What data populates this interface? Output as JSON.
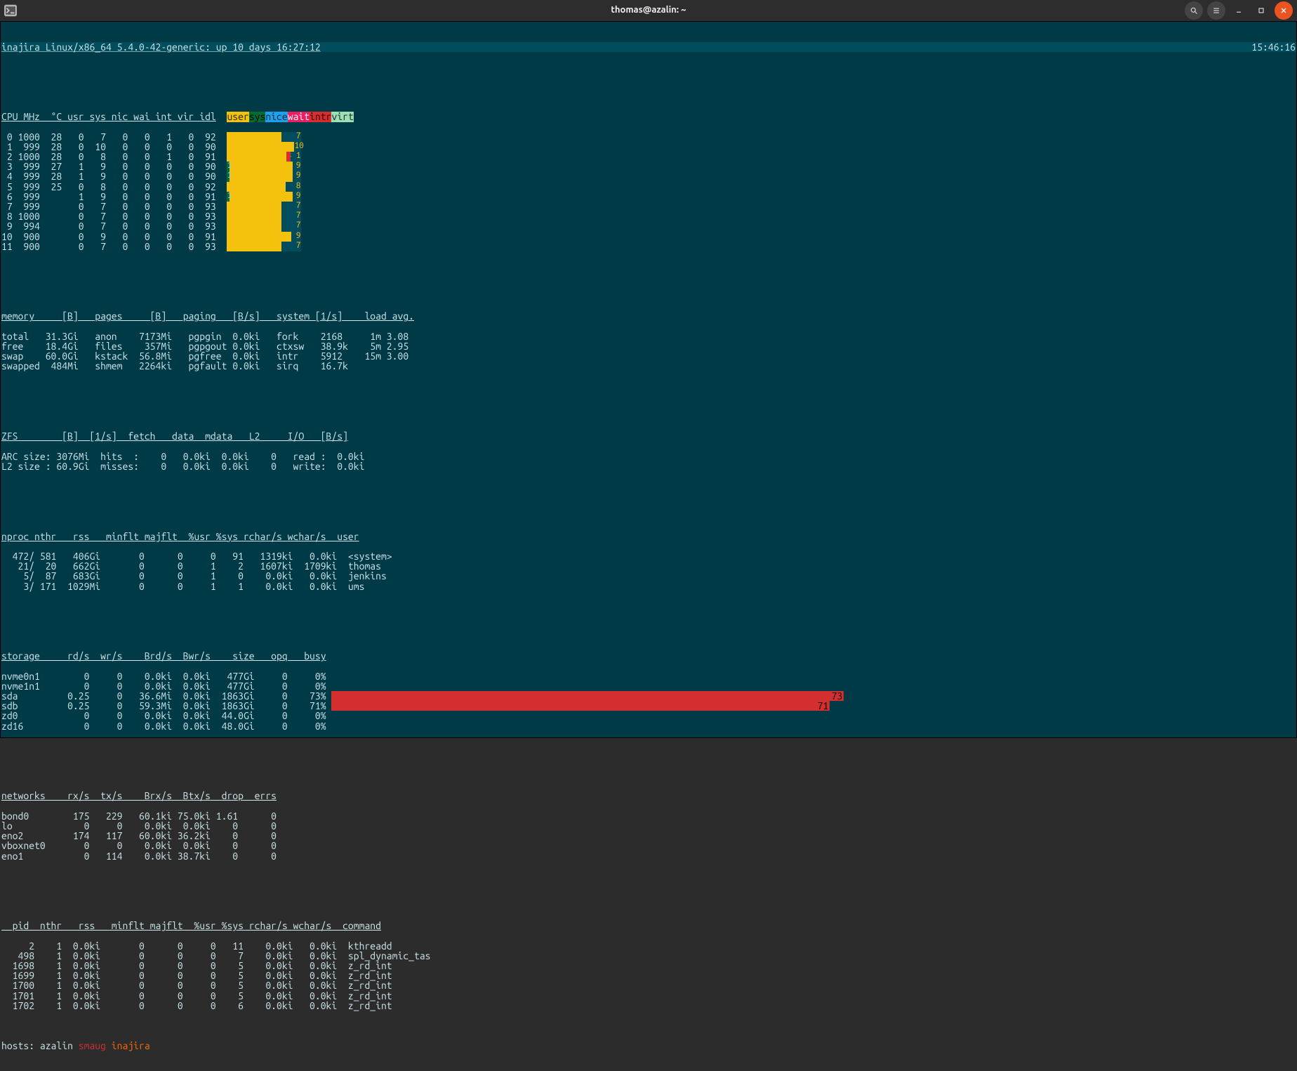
{
  "window": {
    "title": "thomas@azalin: ~",
    "app_icon": "terminal-icon"
  },
  "header": {
    "hostinfo": "inajira Linux/x86_64 5.4.0-42-generic: up 10 days 16:27:12",
    "clock": "15:46:16"
  },
  "cpu": {
    "columns": "CPU MHz  °C usr sys nic wai int vir idl",
    "legend": [
      "user",
      "sys",
      "nice",
      "wait",
      "intr",
      "virt"
    ],
    "rows": [
      {
        "n": 0,
        "mhz": 1000,
        "c": 28,
        "usr": 0,
        "sys": 7,
        "nic": 0,
        "wai": 0,
        "int": 1,
        "vir": 0,
        "idl": 92,
        "bar_sys": 78,
        "bar_wait": 0,
        "label": "7"
      },
      {
        "n": 1,
        "mhz": 999,
        "c": 28,
        "usr": 0,
        "sys": 10,
        "nic": 0,
        "wai": 0,
        "int": 0,
        "vir": 0,
        "idl": 90,
        "bar_sys": 96,
        "bar_wait": 0,
        "label": "10",
        "tail": ""
      },
      {
        "n": 2,
        "mhz": 1000,
        "c": 28,
        "usr": 0,
        "sys": 8,
        "nic": 0,
        "wai": 0,
        "int": 1,
        "vir": 0,
        "idl": 91,
        "bar_sys": 85,
        "bar_wait": 6,
        "label": "8 1"
      },
      {
        "n": 3,
        "mhz": 999,
        "c": 27,
        "usr": 1,
        "sys": 9,
        "nic": 0,
        "wai": 0,
        "int": 0,
        "vir": 0,
        "idl": 90,
        "bar_sys": 94,
        "bar_wait": 0,
        "label": "9",
        "user": "1"
      },
      {
        "n": 4,
        "mhz": 999,
        "c": 28,
        "usr": 1,
        "sys": 9,
        "nic": 0,
        "wai": 0,
        "int": 0,
        "vir": 0,
        "idl": 90,
        "bar_sys": 94,
        "bar_wait": 0,
        "label": "9",
        "user": "1"
      },
      {
        "n": 5,
        "mhz": 999,
        "c": 25,
        "usr": 0,
        "sys": 8,
        "nic": 0,
        "wai": 0,
        "int": 0,
        "vir": 0,
        "idl": 92,
        "bar_sys": 84,
        "bar_wait": 0,
        "label": "8"
      },
      {
        "n": 6,
        "mhz": 999,
        "c": " ",
        "usr": 1,
        "sys": 9,
        "nic": 0,
        "wai": 0,
        "int": 0,
        "vir": 0,
        "idl": 91,
        "bar_sys": 94,
        "bar_wait": 0,
        "label": "9",
        "user": "1"
      },
      {
        "n": 7,
        "mhz": 999,
        "c": " ",
        "usr": 0,
        "sys": 7,
        "nic": 0,
        "wai": 0,
        "int": 0,
        "vir": 0,
        "idl": 93,
        "bar_sys": 78,
        "bar_wait": 0,
        "label": "7"
      },
      {
        "n": 8,
        "mhz": 1000,
        "c": " ",
        "usr": 0,
        "sys": 7,
        "nic": 0,
        "wai": 0,
        "int": 0,
        "vir": 0,
        "idl": 93,
        "bar_sys": 78,
        "bar_wait": 0,
        "label": "7"
      },
      {
        "n": 9,
        "mhz": 994,
        "c": " ",
        "usr": 0,
        "sys": 7,
        "nic": 0,
        "wai": 0,
        "int": 0,
        "vir": 0,
        "idl": 93,
        "bar_sys": 78,
        "bar_wait": 0,
        "label": "7"
      },
      {
        "n": 10,
        "mhz": 900,
        "c": " ",
        "usr": 0,
        "sys": 9,
        "nic": 0,
        "wai": 0,
        "int": 0,
        "vir": 0,
        "idl": 91,
        "bar_sys": 92,
        "bar_wait": 0,
        "label": "9"
      },
      {
        "n": 11,
        "mhz": 900,
        "c": " ",
        "usr": 0,
        "sys": 7,
        "nic": 0,
        "wai": 0,
        "int": 0,
        "vir": 0,
        "idl": 93,
        "bar_sys": 78,
        "bar_wait": 0,
        "label": "7"
      }
    ]
  },
  "memory": {
    "header": "memory     [B]   pages     [B]   paging   [B/s]   system [1/s]    load avg.",
    "rows": [
      "total   31.3Gi   anon    7173Mi   pgpgin  0.0ki   fork    2168     1m 3.08",
      "free    18.4Gi   files    357Mi   pgpgout 0.0ki   ctxsw   38.9k    5m 2.95",
      "swap    60.0Gi   kstack  56.8Mi   pgfree  0.0ki   intr    5912    15m 3.00",
      "swapped  484Mi   shmem   2264ki   pgfault 0.0ki   sirq    16.7k"
    ]
  },
  "zfs": {
    "header": "ZFS        [B]  [1/s]  fetch   data  mdata   L2     I/O   [B/s]",
    "rows": [
      "ARC size: 3076Mi  hits  :    0   0.0ki  0.0ki    0   read :  0.0ki",
      "L2 size : 60.9Gi  misses:    0   0.0ki  0.0ki    0   write:  0.0ki"
    ]
  },
  "nproc": {
    "header": "nproc nthr   rss   minflt majflt  %usr %sys rchar/s wchar/s  user",
    "rows": [
      "  472/ 581   406Gi       0      0     0   91   1319ki   0.0ki  <system>",
      "   21/  20   662Gi       0      0     1    2   1607ki  1709ki  thomas",
      "    5/  87   683Gi       0      0     1    0    0.0ki   0.0ki  jenkins",
      "    3/ 171  1029Mi       0      0     1    1    0.0ki   0.0ki  ums"
    ]
  },
  "storage": {
    "header": "storage     rd/s  wr/s    Brd/s  Bwr/s    size   opq   busy",
    "rows": [
      {
        "txt": "nvme0n1        0     0    0.0ki  0.0ki   477Gi     0     0%",
        "busy": 0
      },
      {
        "txt": "nvme1n1        0     0    0.0ki  0.0ki   477Gi     0     0%",
        "busy": 0
      },
      {
        "txt": "sda         0.25     0   36.6Mi  0.0ki  1863Gi     0    73%",
        "busy": 73,
        "barlabel": "73"
      },
      {
        "txt": "sdb         0.25     0   59.3Mi  0.0ki  1863Gi     0    71%",
        "busy": 71,
        "barlabel": "71"
      },
      {
        "txt": "zd0            0     0    0.0ki  0.0ki  44.0Gi     0     0%",
        "busy": 0
      },
      {
        "txt": "zd16           0     0    0.0ki  0.0ki  48.0Gi     0     0%",
        "busy": 0
      }
    ]
  },
  "networks": {
    "header": "networks    rx/s  tx/s    Brx/s  Btx/s  drop  errs",
    "rows": [
      "bond0        175   229   60.1ki 75.0ki 1.61      0",
      "lo             0     0    0.0ki  0.0ki    0      0",
      "eno2         174   117   60.0ki 36.2ki    0      0",
      "vboxnet0       0     0    0.0ki  0.0ki    0      0",
      "eno1           0   114    0.0ki 38.7ki    0      0"
    ]
  },
  "procs": {
    "header": "  pid  nthr   rss   minflt majflt  %usr %sys rchar/s wchar/s  command",
    "rows": [
      "     2    1  0.0ki       0      0     0   11    0.0ki   0.0ki  kthreadd",
      "   498    1  0.0ki       0      0     0    7    0.0ki   0.0ki  spl_dynamic_tas",
      "  1698    1  0.0ki       0      0     0    5    0.0ki   0.0ki  z_rd_int",
      "  1699    1  0.0ki       0      0     0    5    0.0ki   0.0ki  z_rd_int",
      "  1700    1  0.0ki       0      0     0    5    0.0ki   0.0ki  z_rd_int",
      "  1701    1  0.0ki       0      0     0    5    0.0ki   0.0ki  z_rd_int",
      "  1702    1  0.0ki       0      0     0    6    0.0ki   0.0ki  z_rd_int"
    ]
  },
  "hosts": {
    "prefix": "hosts: azalin ",
    "smaug": "smaug",
    "inajira": " inajira"
  }
}
